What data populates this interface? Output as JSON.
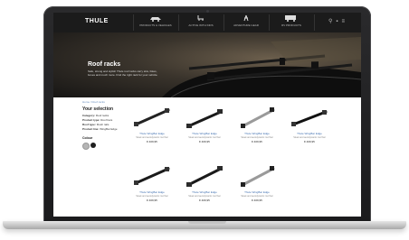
{
  "site": {
    "logo": "THULE"
  },
  "nav": {
    "items": [
      {
        "icon": "car-icon",
        "label": "PRODUCTS & VEHICLES"
      },
      {
        "icon": "stroller-icon",
        "label": "ACTIVE WITH KIDS"
      },
      {
        "icon": "hiking-icon",
        "label": "ADVENTURE GEAR"
      },
      {
        "icon": "rv-icon",
        "label": "RV PRODUCTS"
      }
    ]
  },
  "hero": {
    "title": "Roof racks",
    "text": "Safe, strong and stylish Thule roof racks carry skis, bikes, boxes and much more. Find the right rack for your vehicle."
  },
  "breadcrumb": "Home / Roof racks",
  "filters": {
    "title": "Your selection",
    "rows": [
      {
        "label": "Category:",
        "value": "Roof racks"
      },
      {
        "label": "Product type:",
        "value": "Roof bars"
      },
      {
        "label": "Roof type:",
        "value": "Flush rails"
      },
      {
        "label": "Product line:",
        "value": "WingBar Edge"
      }
    ],
    "colours_title": "Colour",
    "swatches": [
      "#b5b5b5",
      "#1f1f1f"
    ]
  },
  "products": [
    {
      "name": "Thule WingBar Edge",
      "desc": "Sleek and aerodynamic roof bar",
      "price": "€ 409,95"
    },
    {
      "name": "Thule WingBar Edge",
      "desc": "Sleek and aerodynamic roof bar",
      "price": "€ 409,95"
    },
    {
      "name": "Thule WingBar Edge",
      "desc": "Sleek and aerodynamic roof bar",
      "price": "€ 409,95"
    },
    {
      "name": "Thule WingBar Edge",
      "desc": "Sleek and aerodynamic roof bar",
      "price": "€ 409,95"
    },
    {
      "name": "Thule WingBar Edge",
      "desc": "Sleek and aerodynamic roof bar",
      "price": "€ 409,95"
    },
    {
      "name": "Thule WingBar Edge",
      "desc": "Sleek and aerodynamic roof bar",
      "price": "€ 409,95"
    },
    {
      "name": "Thule WingBar Edge",
      "desc": "Sleek and aerodynamic roof bar",
      "price": "€ 409,95"
    }
  ]
}
